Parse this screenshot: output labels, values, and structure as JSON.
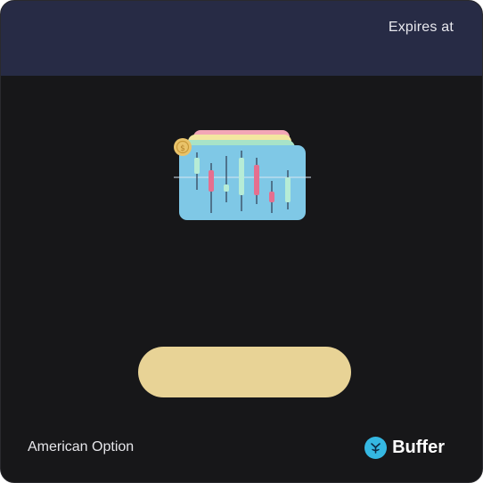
{
  "header": {
    "expires_label": "Expires at"
  },
  "illustration": {
    "icon": "candlestick-chart-card-icon",
    "coin_icon": "coin-icon"
  },
  "cta": {
    "label": "",
    "color": "#e8d396"
  },
  "footer": {
    "option_type": "American Option",
    "brand_name": "Buffer",
    "brand_icon": "buffer-logo-icon",
    "brand_color": "#35b8e2"
  },
  "colors": {
    "header_bg": "#272b45",
    "body_bg": "#171719"
  }
}
